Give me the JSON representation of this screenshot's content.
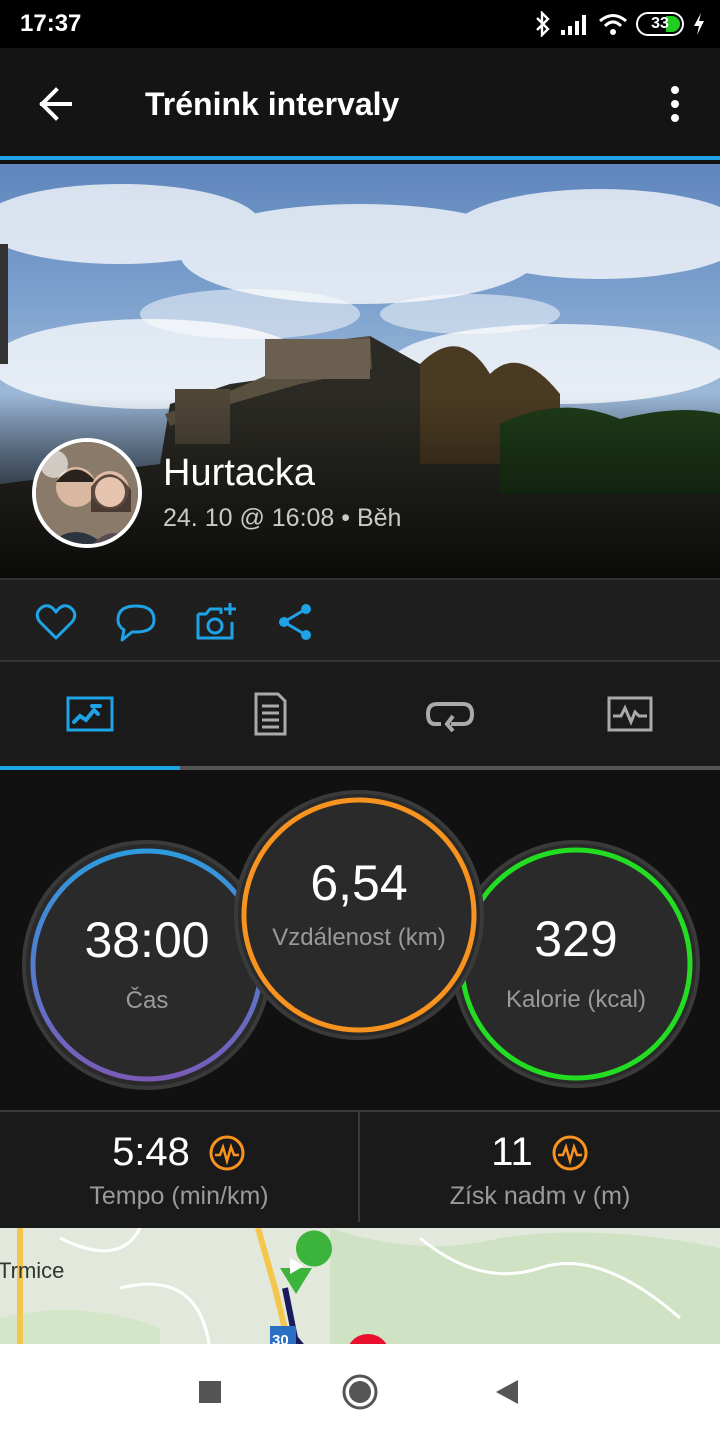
{
  "status_bar": {
    "time": "17:37",
    "battery": "33"
  },
  "app_bar": {
    "title": "Trénink intervaly"
  },
  "activity": {
    "name": "Hurtacka",
    "meta": "24. 10 @ 16:08 • Běh"
  },
  "social": [
    "heart-icon",
    "comment-icon",
    "add-photo-icon",
    "share-icon"
  ],
  "tabs": [
    {
      "icon": "overview-icon",
      "selected": true
    },
    {
      "icon": "details-icon",
      "selected": false
    },
    {
      "icon": "laps-icon",
      "selected": false
    },
    {
      "icon": "charts-icon",
      "selected": false
    }
  ],
  "stats": {
    "time": {
      "value": "38:00",
      "label": "Čas"
    },
    "distance": {
      "value": "6,54",
      "label": "Vzdálenost (km)"
    },
    "calories": {
      "value": "329",
      "label": "Kalorie (kcal)"
    }
  },
  "mini_stats": {
    "pace": {
      "value": "5:48",
      "label": "Tempo (min/km)"
    },
    "elevation": {
      "value": "11",
      "label": "Získ nadm v (m)"
    }
  },
  "map": {
    "town": "Trmice",
    "road_number": "30"
  },
  "colors": {
    "accent": "#1ea3e6",
    "distance_ring": "#f7931e",
    "calories_ring": "#22dd22",
    "time_ring_top": "#2e9be0",
    "time_ring_bottom": "#7a5bb8"
  }
}
